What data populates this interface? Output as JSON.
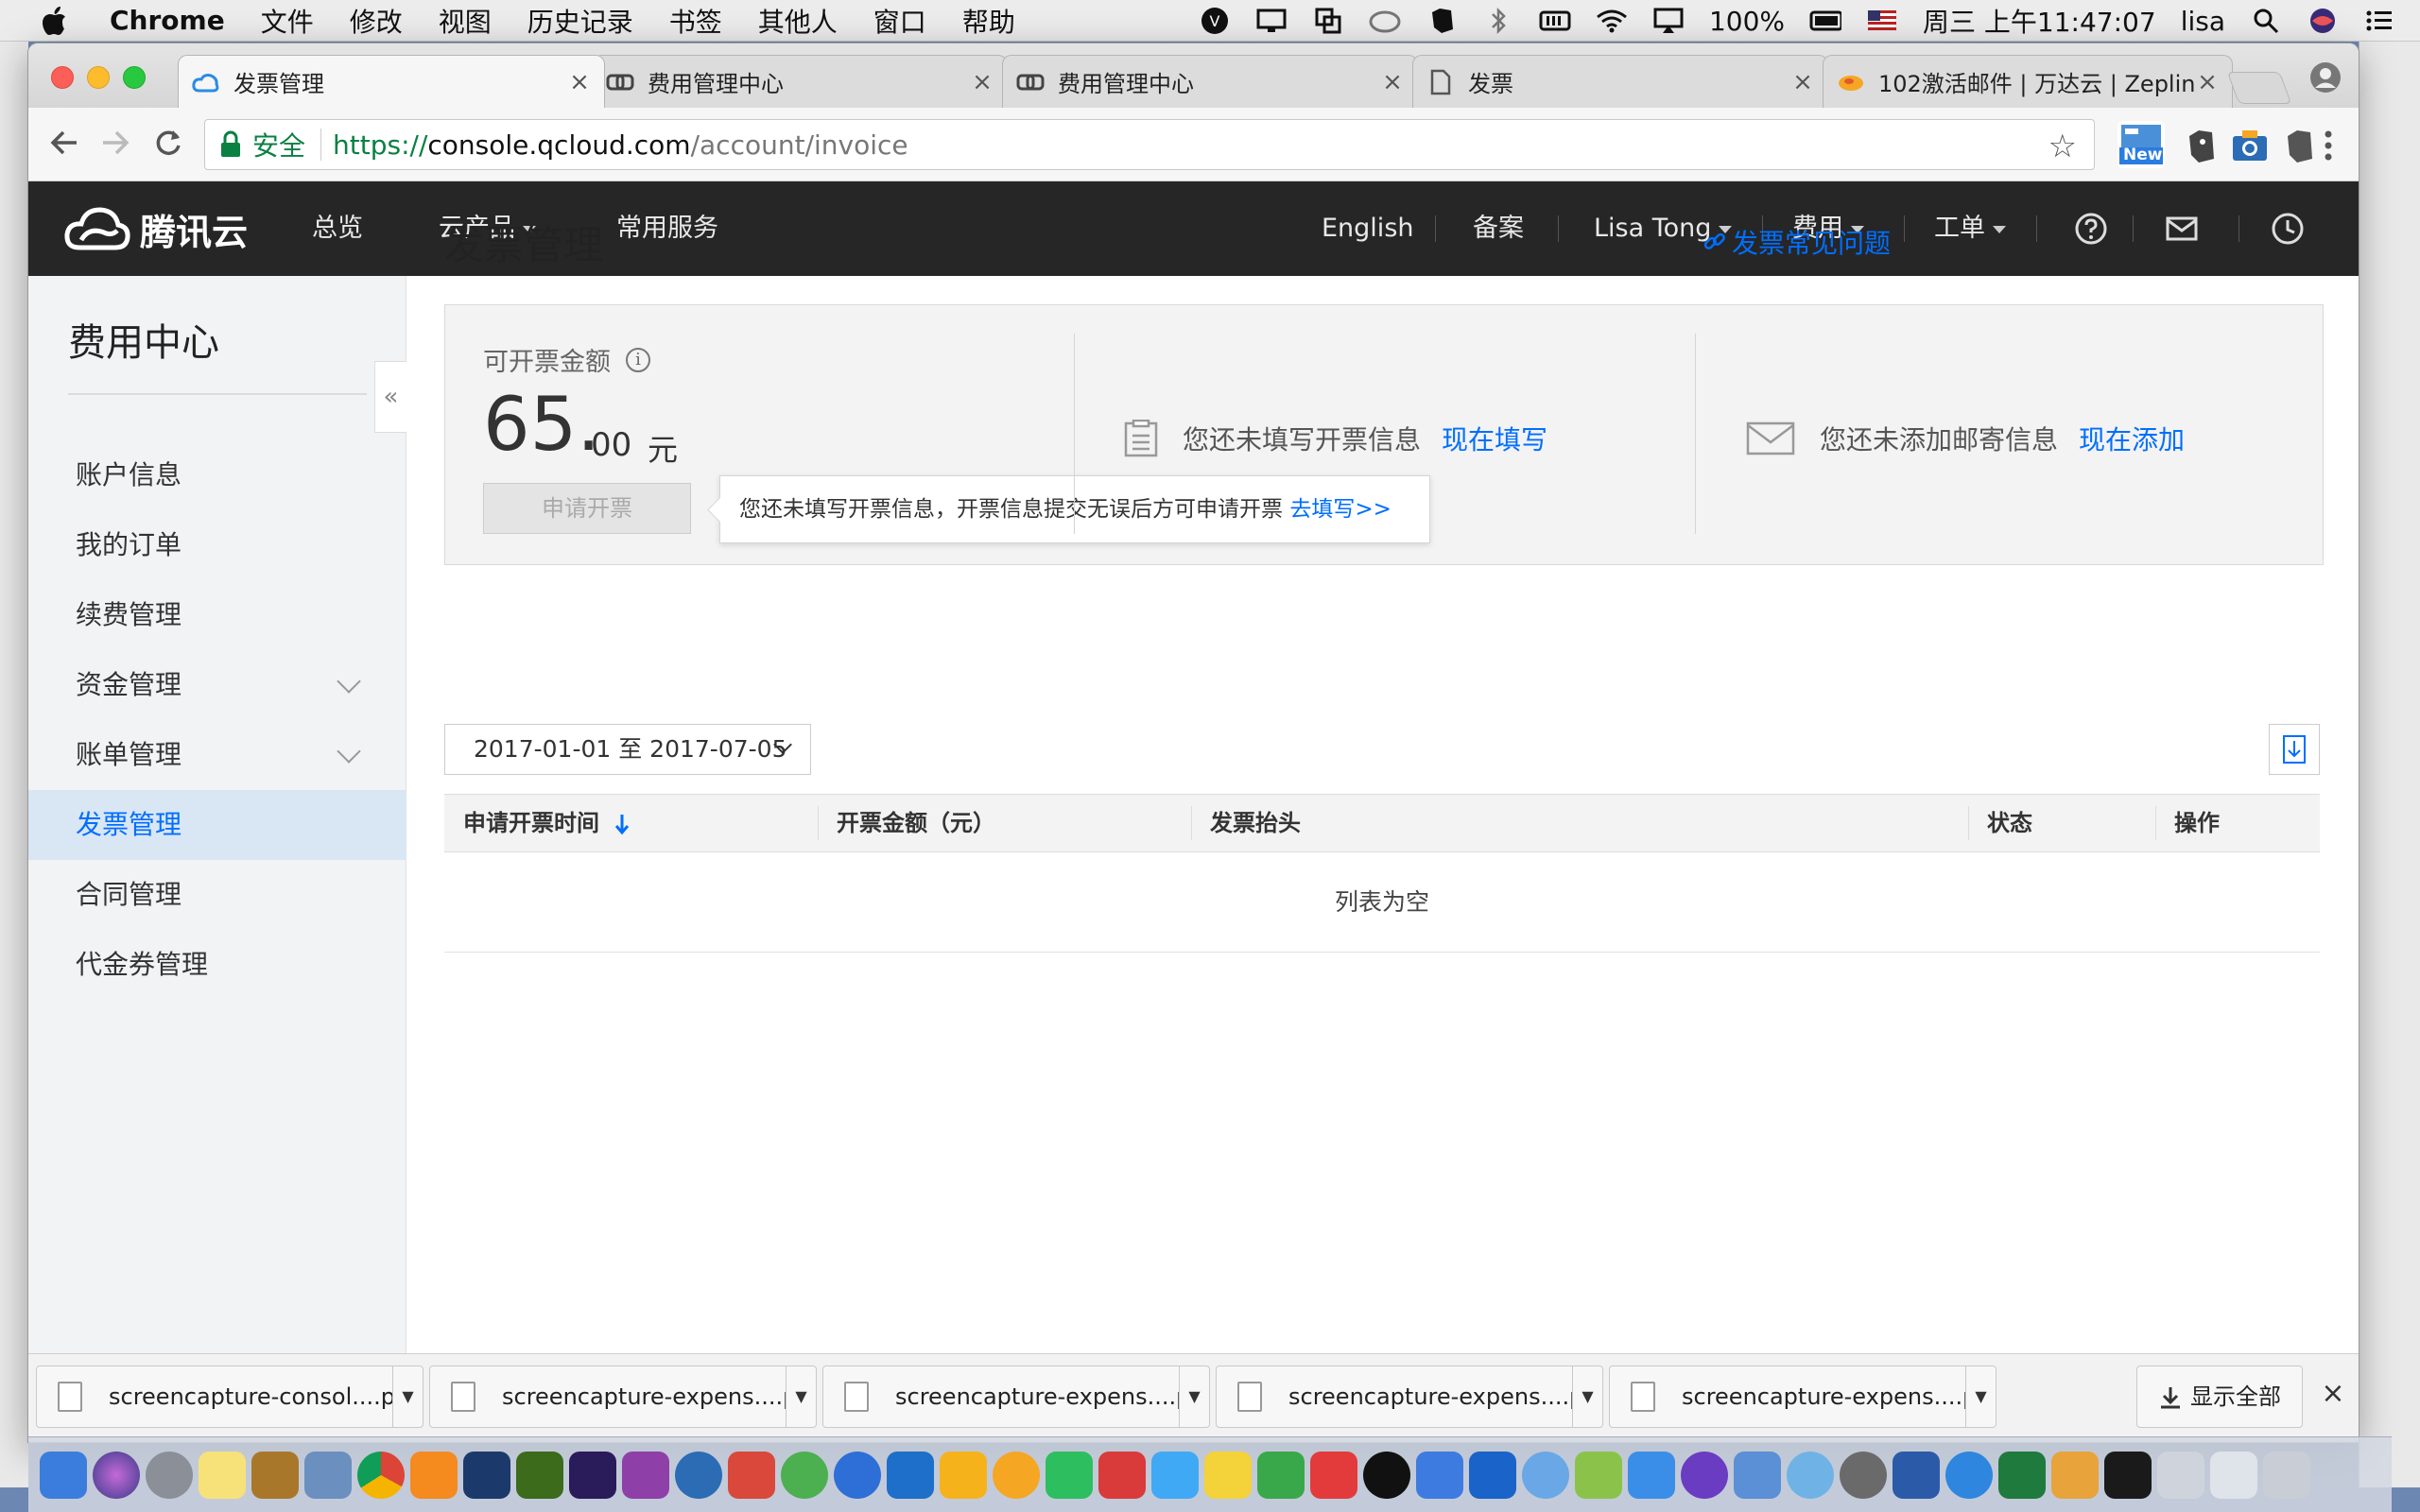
{
  "menubar": {
    "app_name": "Chrome",
    "items": [
      "文件",
      "修改",
      "视图",
      "历史记录",
      "书签",
      "其他人",
      "窗口",
      "帮助"
    ],
    "battery": "100%",
    "datetime": "周三 上午11:47:07",
    "user": "lisa"
  },
  "tabs": [
    {
      "title": "发票管理",
      "icon": "cloud-icon",
      "active": true
    },
    {
      "title": "费用管理中心",
      "icon": "link-icon",
      "active": false
    },
    {
      "title": "费用管理中心",
      "icon": "link-icon",
      "active": false
    },
    {
      "title": "发票",
      "icon": "document-icon",
      "active": false
    },
    {
      "title": "102激活邮件 | 万达云 | Zeplin",
      "icon": "zeplin-icon",
      "active": false
    }
  ],
  "omnibox": {
    "secure_label": "安全",
    "protocol": "https://",
    "host": "console.qcloud.com",
    "path": "/account/invoice"
  },
  "extensions": {
    "new_badge": "New"
  },
  "topnav": {
    "brand": "腾讯云",
    "left_items": [
      "总览",
      "云产品",
      "常用服务"
    ],
    "right_items": [
      "English",
      "备案",
      "Lisa Tong",
      "费用",
      "工单"
    ]
  },
  "sidebar": {
    "title": "费用中心",
    "items": [
      {
        "label": "账户信息"
      },
      {
        "label": "我的订单"
      },
      {
        "label": "续费管理"
      },
      {
        "label": "资金管理"
      },
      {
        "label": "账单管理"
      },
      {
        "label": "发票管理"
      },
      {
        "label": "合同管理"
      },
      {
        "label": "代金券管理"
      }
    ],
    "active_index": 5,
    "collapse_glyph": "«"
  },
  "main": {
    "title": "发票管理",
    "faq_link": "发票常见问题",
    "summary": {
      "amount_label": "可开票金额",
      "amount_integer": "65.",
      "amount_decimal": "00",
      "amount_unit": "元",
      "apply_button": "申请开票",
      "tooltip_text": "您还未填写开票信息，开票信息提交无误后方可申请开票",
      "tooltip_link": "去填写>>",
      "invoice_info_text": "您还未填写开票信息",
      "invoice_info_link": "现在填写",
      "mail_info_text": "您还未添加邮寄信息",
      "mail_info_link": "现在添加"
    },
    "date_range": "2017-01-01 至 2017-07-05",
    "table": {
      "headers": [
        "申请开票时间",
        "开票金额（元）",
        "发票抬头",
        "状态",
        "操作"
      ],
      "empty_text": "列表为空"
    }
  },
  "downloads": {
    "files": [
      "screencapture-consol....png",
      "screencapture-expens....png",
      "screencapture-expens....png",
      "screencapture-expens....png",
      "screencapture-expens....png"
    ],
    "show_all": "显示全部"
  },
  "colors": {
    "accent": "#006eff",
    "topnav_bg": "#262626",
    "sidebar_active_bg": "#d9e6f4",
    "secure_green": "#0b8043"
  }
}
